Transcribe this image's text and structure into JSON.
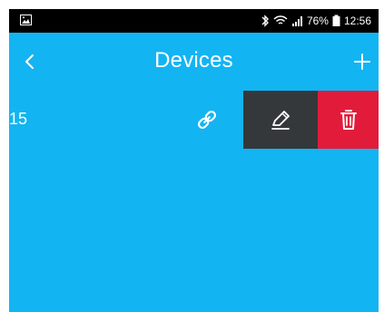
{
  "status_bar": {
    "battery": "76%",
    "time": "12:56",
    "icons": [
      "image-icon",
      "bluetooth-icon",
      "wifi-icon",
      "signal-icon",
      "battery-icon"
    ]
  },
  "app_bar": {
    "title": "Devices",
    "back_icon": "chevron-left-icon",
    "add_icon": "plus-icon"
  },
  "devices": [
    {
      "name": "15",
      "link_icon": "link-icon",
      "actions": [
        {
          "name": "edit",
          "icon": "pencil-icon"
        },
        {
          "name": "delete",
          "icon": "trash-icon"
        }
      ]
    }
  ],
  "colors": {
    "app_background": "#13b4f2",
    "status_bar": "#000000",
    "edit_action": "#34383a",
    "delete_action": "#e31b3b"
  }
}
